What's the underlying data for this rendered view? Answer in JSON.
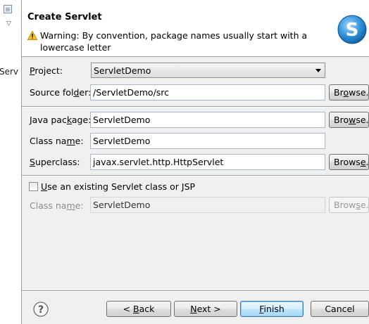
{
  "background": {
    "partial_label": "Serv"
  },
  "dialog": {
    "title": "Create Servlet",
    "warning": "Warning: By convention, package names usually start with a lowercase letter",
    "logo_letter": "S",
    "logo_color": "#2a8fd8"
  },
  "form": {
    "project": {
      "label_pre": "",
      "label_ul": "P",
      "label_post": "roject:",
      "value": "ServletDemo"
    },
    "source_folder": {
      "label_pre": "Source fol",
      "label_ul": "d",
      "label_post": "er:",
      "value": "/ServletDemo/src",
      "button_pre": "Br",
      "button_ul": "o",
      "button_post": "wse..."
    },
    "java_package": {
      "label_pre": "Java pac",
      "label_ul": "k",
      "label_post": "age:",
      "value": "ServletDemo",
      "button_pre": "Bro",
      "button_ul": "w",
      "button_post": "se..."
    },
    "class_name": {
      "label_pre": "Class na",
      "label_ul": "m",
      "label_post": "e:",
      "value": "ServletDemo"
    },
    "superclass": {
      "label_pre": "",
      "label_ul": "S",
      "label_post": "uperclass:",
      "value": "javax.servlet.http.HttpServlet",
      "button_pre": "Brows",
      "button_ul": "e",
      "button_post": "..."
    },
    "existing": {
      "checkbox_pre": "",
      "checkbox_ul": "U",
      "checkbox_post": "se an existing Servlet class or JSP",
      "checked": false,
      "label_pre": "Class na",
      "label_ul": "m",
      "label_post": "e:",
      "value": "ServletDemo",
      "button_pre": "Brow",
      "button_ul": "s",
      "button_post": "e..."
    }
  },
  "footer": {
    "help_glyph": "?",
    "back": {
      "pre": "< ",
      "ul": "B",
      "post": "ack"
    },
    "next": {
      "pre": "",
      "ul": "N",
      "post": "ext >"
    },
    "finish": {
      "pre": "",
      "ul": "F",
      "post": "inish"
    },
    "cancel": {
      "pre": "Cancel",
      "ul": "",
      "post": ""
    }
  }
}
